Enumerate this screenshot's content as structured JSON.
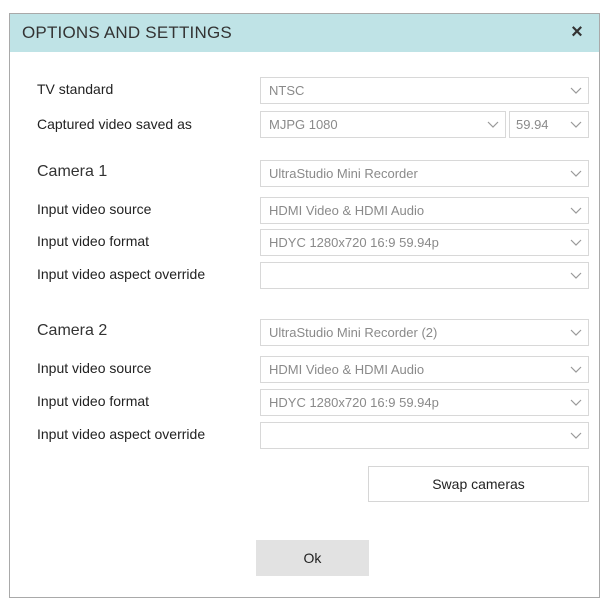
{
  "dialog": {
    "title": "OPTIONS AND SETTINGS",
    "close_glyph": "×"
  },
  "general": {
    "tv_standard_label": "TV standard",
    "tv_standard_value": "NTSC",
    "captured_label": "Captured video saved as",
    "captured_format": "MJPG 1080",
    "captured_rate": "59.94"
  },
  "camera1": {
    "heading": "Camera 1",
    "device": "UltraStudio Mini Recorder",
    "source_label": "Input video source",
    "source_value": "HDMI Video & HDMI Audio",
    "format_label": "Input video format",
    "format_value": "HDYC 1280x720 16:9 59.94p",
    "aspect_label": "Input video aspect override",
    "aspect_value": ""
  },
  "camera2": {
    "heading": "Camera 2",
    "device": "UltraStudio Mini Recorder (2)",
    "source_label": "Input video source",
    "source_value": "HDMI Video & HDMI Audio",
    "format_label": "Input video format",
    "format_value": "HDYC 1280x720 16:9 59.94p",
    "aspect_label": "Input video aspect override",
    "aspect_value": ""
  },
  "buttons": {
    "swap": "Swap cameras",
    "ok": "Ok"
  },
  "icons": {
    "dropdown": "chevron-down-icon",
    "close": "close-icon"
  },
  "colors": {
    "titlebar": "#bfe3e6",
    "ok_button": "#e2e2e2",
    "field_border": "#d8d8d8"
  }
}
